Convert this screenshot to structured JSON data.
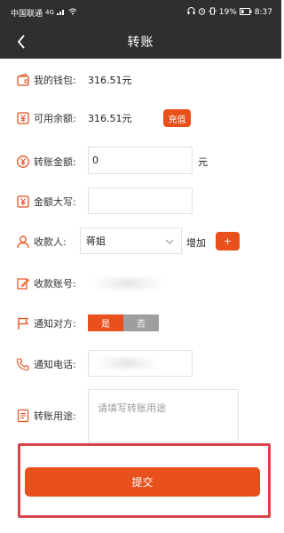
{
  "status_bar": {
    "carrier": "中国联通",
    "signal": "4G",
    "battery": "19%",
    "time": "8:37"
  },
  "nav": {
    "back_icon": "chevron-left-icon",
    "title": "转账"
  },
  "wallet": {
    "label": "我的钱包:",
    "value": "316.51元",
    "icon": "wallet-icon"
  },
  "available": {
    "label": "可用余额:",
    "value": "316.51元",
    "recharge_label": "充值",
    "icon": "yen-card-icon"
  },
  "amount": {
    "label": "转账金额:",
    "value": "0",
    "unit": "元",
    "icon": "yen-coin-icon"
  },
  "amount_upper": {
    "label": "金额大写:",
    "value": "",
    "icon": "yen-card-icon"
  },
  "payee": {
    "label": "收款人:",
    "selected": "蒋姐",
    "add_label": "增加",
    "add_button": "+",
    "icon": "user-icon"
  },
  "account": {
    "label": "收款账号:",
    "icon": "pencil-edit-icon"
  },
  "notify": {
    "label": "通知对方:",
    "yes": "是",
    "no": "否",
    "icon": "flag-icon"
  },
  "phone": {
    "label": "通知电话:",
    "icon": "phone-icon"
  },
  "purpose": {
    "label": "转账用途:",
    "placeholder": "请填写转账用途",
    "icon": "document-icon"
  },
  "submit": {
    "label": "提交"
  },
  "colors": {
    "accent": "#e8501c",
    "header": "#2f2f2f",
    "toggle_off": "#9e9e9e",
    "highlight": "#d9434b"
  }
}
